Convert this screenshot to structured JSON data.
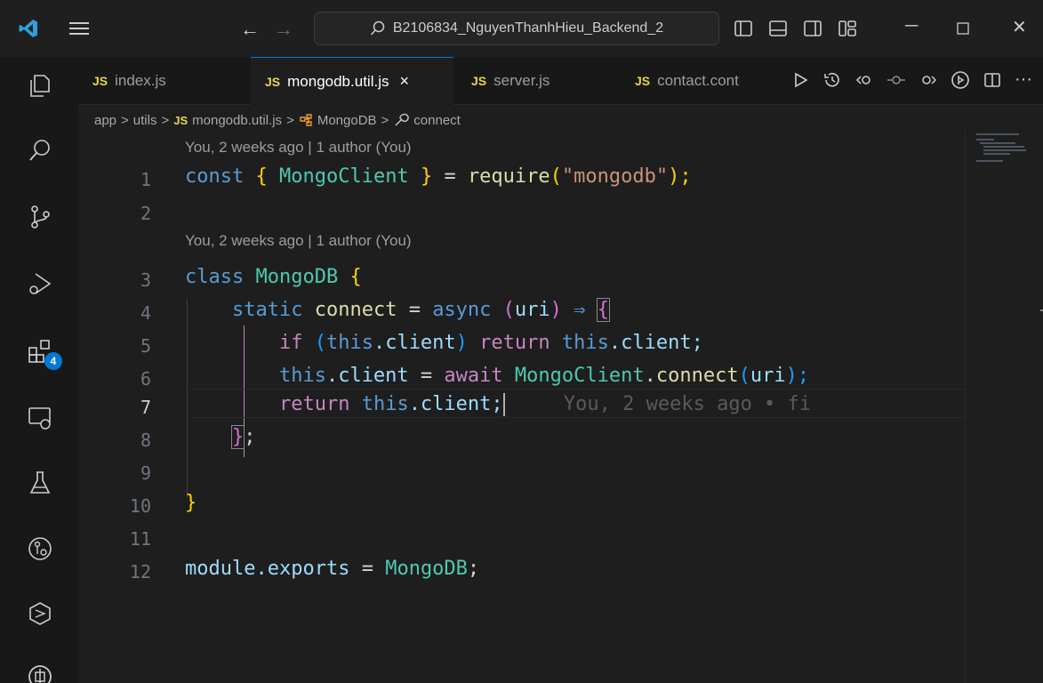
{
  "titlebar": {
    "search_text": "B2106834_NguyenThanhHieu_Backend_2"
  },
  "activity": {
    "extensions_badge": "4"
  },
  "tabs": [
    {
      "prefix": "JS",
      "label": "index.js"
    },
    {
      "prefix": "JS",
      "label": "mongodb.util.js",
      "close": "×"
    },
    {
      "prefix": "JS",
      "label": "server.js"
    },
    {
      "prefix": "JS",
      "label": "contact.cont"
    }
  ],
  "breadcrumb": {
    "folder1": "app",
    "folder2": "utils",
    "file_prefix": "JS",
    "file": "mongodb.util.js",
    "class": "MongoDB",
    "method": "connect",
    "sep": ">"
  },
  "codelens": {
    "line1": "You, 2 weeks ago | 1 author (You)",
    "line3": "You, 2 weeks ago | 1 author (You)"
  },
  "line_numbers": [
    "1",
    "2",
    "3",
    "4",
    "5",
    "6",
    "7",
    "8",
    "9",
    "10",
    "11",
    "12"
  ],
  "code": {
    "l1": {
      "a": "const",
      "b": "{",
      "c": "MongoClient",
      "d": "}",
      "e": "=",
      "f": "require",
      "g": "(",
      "h": "\"mongodb\"",
      "i": ");"
    },
    "l3": {
      "a": "class",
      "b": "MongoDB",
      "c": "{"
    },
    "l4": {
      "a": "static",
      "b": "connect",
      "c": "=",
      "d": "async",
      "e": "(",
      "f": "uri",
      "g": ")",
      "h": "⇒",
      "i": "{"
    },
    "l5": {
      "a": "if",
      "b": "(",
      "c": "this",
      "d": ".client",
      "e": ")",
      "f": "return",
      "g": "this",
      "h": ".client;"
    },
    "l6": {
      "a": "this",
      "b": ".client",
      "c": "=",
      "d": "await",
      "e": "MongoClient",
      "f": ".connect",
      "g": "(",
      "h": "uri",
      "i": ");"
    },
    "l7": {
      "a": "return",
      "b": "this",
      "c": ".client;",
      "ghost": "You, 2 weeks ago • fi"
    },
    "l8": {
      "a": "}",
      "b": ";"
    },
    "l10": {
      "a": "}"
    },
    "l12": {
      "a": "module",
      "b": ".exports",
      "c": "=",
      "d": "MongoDB",
      "e": ";"
    }
  },
  "colors": {
    "accent": "#0078d4",
    "js_badge": "#e8d44d"
  }
}
